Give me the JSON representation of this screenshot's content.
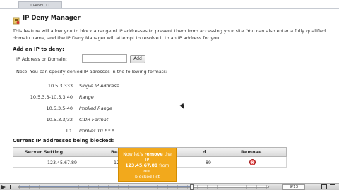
{
  "cpanel_tab": "CPANEL 11",
  "page": {
    "title": "IP Deny Manager",
    "description": "This feature will allow you to block a range of IP addresses to prevent them from accessing your site. You can also enter a fully qualified domain name, and the IP Deny Manager will attempt to resolve it to an IP address for you."
  },
  "add_section": {
    "heading": "Add an IP to deny:",
    "label": "IP Address or Domain:",
    "input_value": "",
    "button_label": "Add"
  },
  "formats": {
    "note": "Note: You can specify denied IP adresses in the following formats:",
    "rows": [
      {
        "ip": "10.5.3.333",
        "desc": "Single IP Address"
      },
      {
        "ip": "10.5.3.3-10.5.3.40",
        "desc": "Range"
      },
      {
        "ip": "10.5.3.5-40",
        "desc": "Implied Range"
      },
      {
        "ip": "10.5.3.3/32",
        "desc": "CIDR Format"
      },
      {
        "ip": "10.",
        "desc": "Implies 10.*.*.*"
      }
    ]
  },
  "blocked": {
    "heading": "Current IP addresses being blocked:",
    "columns": [
      "Server Setting",
      "Begi",
      "d",
      "Remove"
    ],
    "rows": [
      {
        "server_setting": "123.45.67.89",
        "beginning": "123.",
        "end": "89"
      }
    ]
  },
  "tooltip": {
    "line1_prefix": "Now let's",
    "line1_bold": "remove",
    "line1_suffix": "the IP",
    "line2": "123.45.67.89",
    "line2_suffix": "from our",
    "line3": "blocked list"
  },
  "player": {
    "slide_counter": "9/13",
    "progress": 0.69
  }
}
